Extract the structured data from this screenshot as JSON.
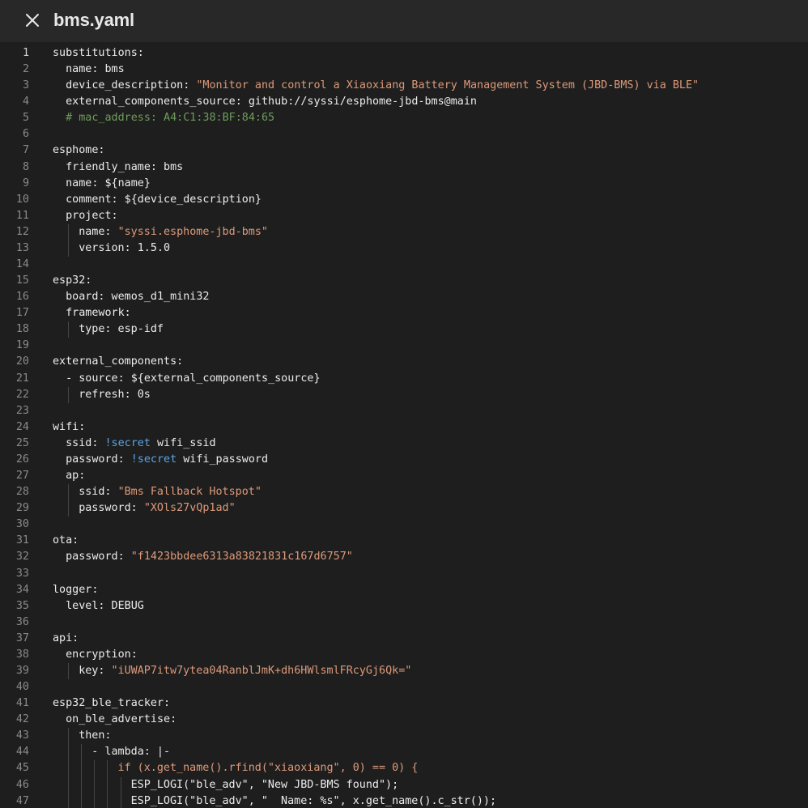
{
  "file": {
    "title": "bms.yaml"
  },
  "icons": {
    "close": "close-icon"
  },
  "colors": {
    "background": "#1e1e1e",
    "header_background": "#282828",
    "text": "#ececec",
    "string": "#dd9a7a",
    "comment": "#6f9c5c",
    "tag": "#5aa3e6",
    "line_number": "#8a8a8a"
  },
  "editor": {
    "active_line": 1,
    "lines": [
      {
        "n": "1",
        "indent": 0,
        "tokens": [
          [
            "k",
            "substitutions:"
          ]
        ]
      },
      {
        "n": "2",
        "indent": 1,
        "tokens": [
          [
            "k",
            "name: bms"
          ]
        ]
      },
      {
        "n": "3",
        "indent": 1,
        "tokens": [
          [
            "k",
            "device_description: "
          ],
          [
            "s",
            "\"Monitor and control a Xiaoxiang Battery Management System (JBD-BMS) via BLE\""
          ]
        ]
      },
      {
        "n": "4",
        "indent": 1,
        "tokens": [
          [
            "k",
            "external_components_source: github://syssi/esphome-jbd-bms@main"
          ]
        ]
      },
      {
        "n": "5",
        "indent": 1,
        "tokens": [
          [
            "c",
            "# mac_address: A4:C1:38:BF:84:65"
          ]
        ]
      },
      {
        "n": "6",
        "indent": 0,
        "tokens": []
      },
      {
        "n": "7",
        "indent": 0,
        "tokens": [
          [
            "k",
            "esphome:"
          ]
        ]
      },
      {
        "n": "8",
        "indent": 1,
        "tokens": [
          [
            "k",
            "friendly_name: bms"
          ]
        ]
      },
      {
        "n": "9",
        "indent": 1,
        "tokens": [
          [
            "k",
            "name: ${name}"
          ]
        ]
      },
      {
        "n": "10",
        "indent": 1,
        "tokens": [
          [
            "k",
            "comment: ${device_description}"
          ]
        ]
      },
      {
        "n": "11",
        "indent": 1,
        "tokens": [
          [
            "k",
            "project:"
          ]
        ]
      },
      {
        "n": "12",
        "indent": 2,
        "tokens": [
          [
            "k",
            "name: "
          ],
          [
            "s",
            "\"syssi.esphome-jbd-bms\""
          ]
        ]
      },
      {
        "n": "13",
        "indent": 2,
        "tokens": [
          [
            "k",
            "version: 1.5.0"
          ]
        ]
      },
      {
        "n": "14",
        "indent": 0,
        "tokens": []
      },
      {
        "n": "15",
        "indent": 0,
        "tokens": [
          [
            "k",
            "esp32:"
          ]
        ]
      },
      {
        "n": "16",
        "indent": 1,
        "tokens": [
          [
            "k",
            "board: wemos_d1_mini32"
          ]
        ]
      },
      {
        "n": "17",
        "indent": 1,
        "tokens": [
          [
            "k",
            "framework:"
          ]
        ]
      },
      {
        "n": "18",
        "indent": 2,
        "tokens": [
          [
            "k",
            "type: esp-idf"
          ]
        ]
      },
      {
        "n": "19",
        "indent": 0,
        "tokens": []
      },
      {
        "n": "20",
        "indent": 0,
        "tokens": [
          [
            "k",
            "external_components:"
          ]
        ]
      },
      {
        "n": "21",
        "indent": 1,
        "tokens": [
          [
            "k",
            "- source: ${external_components_source}"
          ]
        ]
      },
      {
        "n": "22",
        "indent": 2,
        "tokens": [
          [
            "k",
            "refresh: 0s"
          ]
        ]
      },
      {
        "n": "23",
        "indent": 0,
        "tokens": []
      },
      {
        "n": "24",
        "indent": 0,
        "tokens": [
          [
            "k",
            "wifi:"
          ]
        ]
      },
      {
        "n": "25",
        "indent": 1,
        "tokens": [
          [
            "k",
            "ssid: "
          ],
          [
            "t",
            "!secret"
          ],
          [
            "k",
            " wifi_ssid"
          ]
        ]
      },
      {
        "n": "26",
        "indent": 1,
        "tokens": [
          [
            "k",
            "password: "
          ],
          [
            "t",
            "!secret"
          ],
          [
            "k",
            " wifi_password"
          ]
        ]
      },
      {
        "n": "27",
        "indent": 1,
        "tokens": [
          [
            "k",
            "ap:"
          ]
        ]
      },
      {
        "n": "28",
        "indent": 2,
        "tokens": [
          [
            "k",
            "ssid: "
          ],
          [
            "s",
            "\"Bms Fallback Hotspot\""
          ]
        ]
      },
      {
        "n": "29",
        "indent": 2,
        "tokens": [
          [
            "k",
            "password: "
          ],
          [
            "s",
            "\"XOls27vQp1ad\""
          ]
        ]
      },
      {
        "n": "30",
        "indent": 0,
        "tokens": []
      },
      {
        "n": "31",
        "indent": 0,
        "tokens": [
          [
            "k",
            "ota:"
          ]
        ]
      },
      {
        "n": "32",
        "indent": 1,
        "tokens": [
          [
            "k",
            "password: "
          ],
          [
            "s",
            "\"f1423bbdee6313a83821831c167d6757\""
          ]
        ]
      },
      {
        "n": "33",
        "indent": 0,
        "tokens": []
      },
      {
        "n": "34",
        "indent": 0,
        "tokens": [
          [
            "k",
            "logger:"
          ]
        ]
      },
      {
        "n": "35",
        "indent": 1,
        "tokens": [
          [
            "k",
            "level: DEBUG"
          ]
        ]
      },
      {
        "n": "36",
        "indent": 0,
        "tokens": []
      },
      {
        "n": "37",
        "indent": 0,
        "tokens": [
          [
            "k",
            "api:"
          ]
        ]
      },
      {
        "n": "38",
        "indent": 1,
        "tokens": [
          [
            "k",
            "encryption:"
          ]
        ]
      },
      {
        "n": "39",
        "indent": 2,
        "tokens": [
          [
            "k",
            "key: "
          ],
          [
            "s",
            "\"iUWAP7itw7ytea04RanblJmK+dh6HWlsmlFRcyGj6Qk=\""
          ]
        ]
      },
      {
        "n": "40",
        "indent": 0,
        "tokens": []
      },
      {
        "n": "41",
        "indent": 0,
        "tokens": [
          [
            "k",
            "esp32_ble_tracker:"
          ]
        ]
      },
      {
        "n": "42",
        "indent": 1,
        "tokens": [
          [
            "k",
            "on_ble_advertise:"
          ]
        ]
      },
      {
        "n": "43",
        "indent": 2,
        "tokens": [
          [
            "k",
            "then:"
          ]
        ]
      },
      {
        "n": "44",
        "indent": 3,
        "tokens": [
          [
            "k",
            "- lambda: |-"
          ]
        ]
      },
      {
        "n": "45",
        "indent": 5,
        "tokens": [
          [
            "s",
            "if (x.get_name().rfind(\"xiaoxiang\", 0) == 0) {"
          ]
        ]
      },
      {
        "n": "46",
        "indent": 6,
        "tokens": [
          [
            "k",
            "ESP_LOGI(\"ble_adv\", \"New JBD-BMS found\");"
          ]
        ]
      },
      {
        "n": "47",
        "indent": 6,
        "tokens": [
          [
            "k",
            "ESP_LOGI(\"ble_adv\", \"  Name: %s\", x.get_name().c_str());"
          ]
        ]
      }
    ]
  }
}
